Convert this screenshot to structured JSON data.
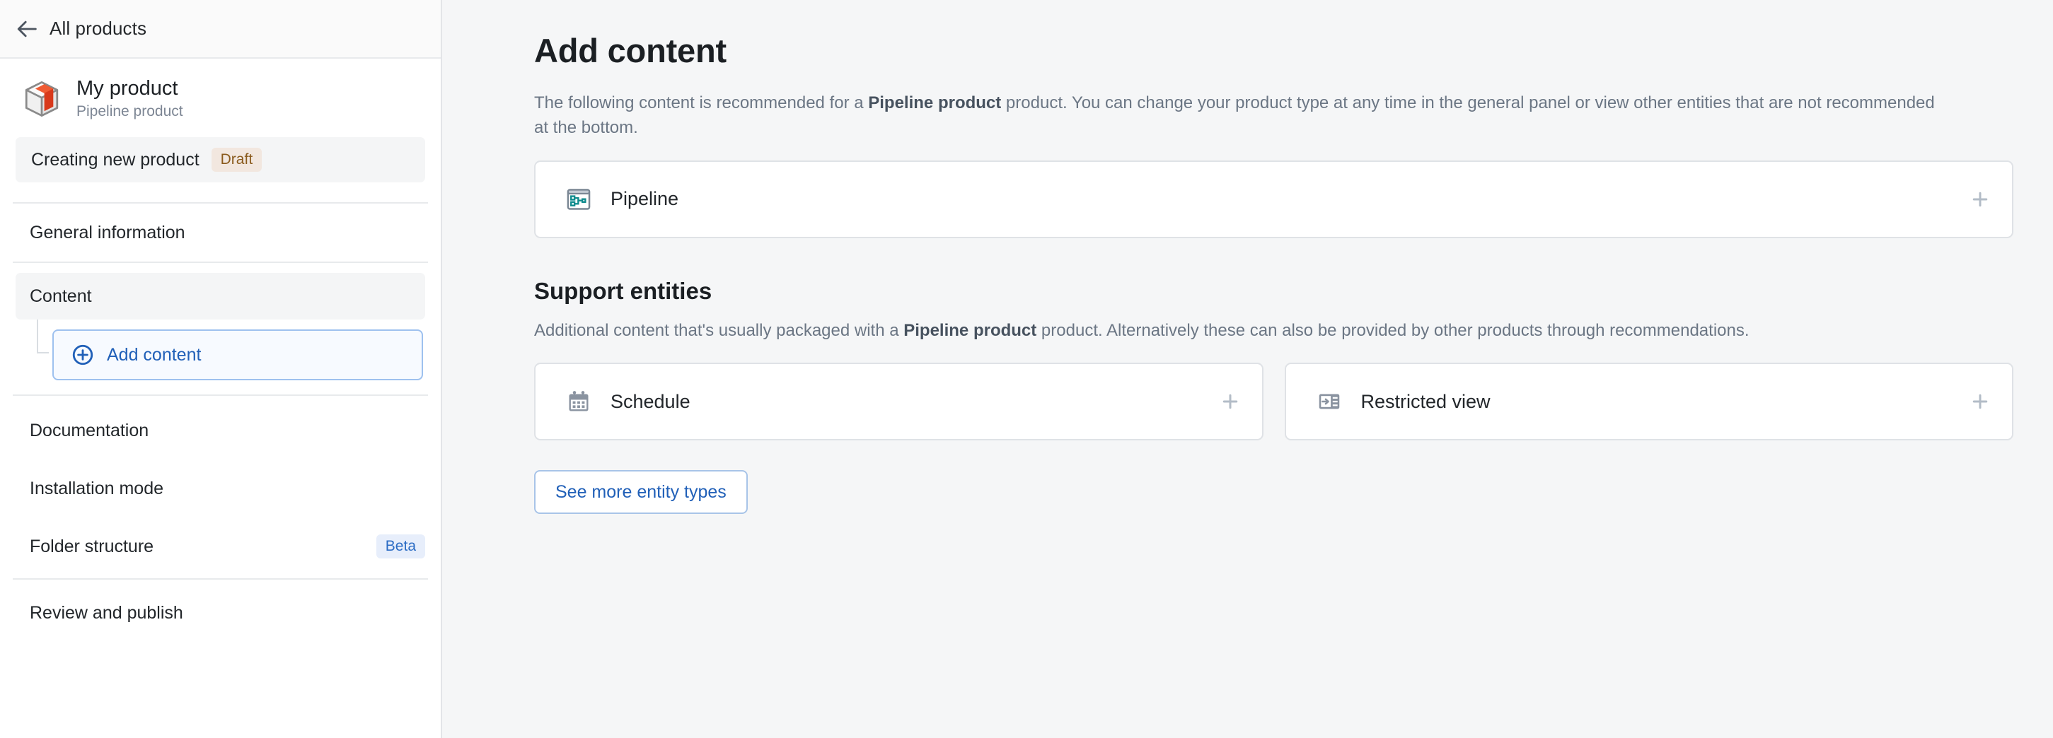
{
  "sidebar": {
    "back_link": {
      "label": "All products",
      "icon": "arrow-left-icon"
    },
    "product": {
      "name": "My product",
      "type": "Pipeline product",
      "icon": "package-box-icon"
    },
    "status_row": {
      "label": "Creating new product",
      "badge": "Draft"
    },
    "nav": [
      {
        "label": "General information",
        "badge": ""
      },
      {
        "label": "Content",
        "badge": ""
      },
      {
        "label": "Documentation",
        "badge": ""
      },
      {
        "label": "Installation mode",
        "badge": ""
      },
      {
        "label": "Folder structure",
        "badge": "Beta"
      },
      {
        "label": "Review and publish",
        "badge": ""
      }
    ],
    "add_content_button": {
      "label": "Add content",
      "icon": "plus-circle-icon"
    }
  },
  "main": {
    "title": "Add content",
    "description_parts": {
      "p1": "The following content is recommended for a ",
      "b1": "Pipeline product",
      "p2": " product. You can change your product type at any time in the general panel or view other entities that are not recommended at the bottom."
    },
    "primary_entity": {
      "label": "Pipeline",
      "icon": "pipeline-icon",
      "add_icon": "plus-icon"
    },
    "support_section": {
      "title": "Support entities",
      "description_parts": {
        "p1": "Additional content that's usually packaged with a ",
        "b1": "Pipeline product",
        "p2": " product. Alternatively these can also be provided by other products through recommendations."
      },
      "entities": [
        {
          "label": "Schedule",
          "icon": "calendar-icon",
          "add_icon": "plus-icon"
        },
        {
          "label": "Restricted view",
          "icon": "restricted-view-icon",
          "add_icon": "plus-icon"
        }
      ]
    },
    "see_more_button": {
      "label": "See more entity types"
    }
  },
  "colors": {
    "accent_blue": "#2160b8",
    "draft_badge_bg": "#f2e7df",
    "draft_badge_fg": "#8a5a1c",
    "beta_badge_bg": "#e7eefb",
    "beta_badge_fg": "#2b6cc4",
    "main_bg": "#f5f6f7",
    "pipeline_icon_teal": "#0f8b8d",
    "product_icon_red": "#d8391b"
  }
}
